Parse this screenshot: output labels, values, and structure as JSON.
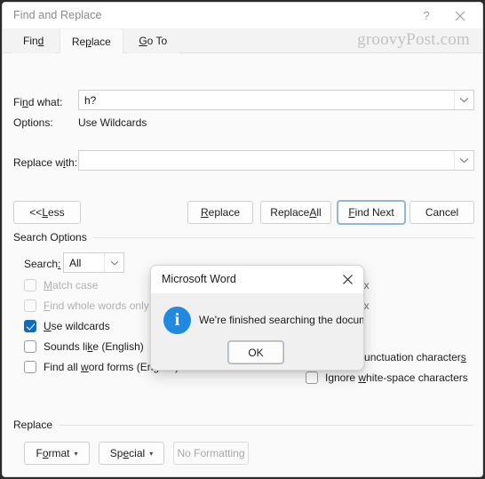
{
  "window": {
    "title": "Find and Replace",
    "help_icon": "question-mark-icon",
    "close_icon": "close-icon",
    "watermark": "groovyPost.com"
  },
  "tabs": [
    {
      "label": "Find",
      "prefix": "Fin",
      "accel": "d",
      "suffix": "",
      "active": false
    },
    {
      "label": "Replace",
      "prefix": "Re",
      "accel": "p",
      "suffix": "lace",
      "active": true
    },
    {
      "label": "Go To",
      "prefix": "",
      "accel": "G",
      "suffix": "o To",
      "active": false
    }
  ],
  "find": {
    "label_prefix": "Fi",
    "label_accel": "n",
    "label_suffix": "d what:",
    "value": "h?",
    "placeholder": "",
    "dropdown_icon": "chevron-down-icon"
  },
  "options": {
    "label": "Options:",
    "value": "Use Wildcards"
  },
  "replace": {
    "label_prefix": "Replace w",
    "label_accel": "i",
    "label_suffix": "th:",
    "value": "",
    "placeholder": "",
    "dropdown_icon": "chevron-down-icon"
  },
  "buttons": {
    "less": {
      "prefix": "<< ",
      "accel": "L",
      "suffix": "ess"
    },
    "replace": {
      "prefix": "",
      "accel": "R",
      "suffix": "eplace"
    },
    "replace_all": {
      "prefix": "Replace ",
      "accel": "A",
      "suffix": "ll"
    },
    "find_next": {
      "prefix": "",
      "accel": "F",
      "suffix": "ind Next",
      "focused": true
    },
    "cancel": {
      "prefix": "Cancel",
      "accel": "",
      "suffix": ""
    }
  },
  "search_options": {
    "group_label": "Search Options",
    "search_label_prefix": "Search",
    "search_label_accel": ":",
    "search_value": "All",
    "search_dropdown_icon": "chevron-down-icon",
    "left_checkboxes": [
      {
        "prefix": "",
        "accel": "M",
        "suffix": "atch case",
        "checked": false,
        "disabled": true
      },
      {
        "prefix": "",
        "accel": "F",
        "suffix": "ind whole words only",
        "checked": false,
        "disabled": true
      },
      {
        "prefix": "",
        "accel": "U",
        "suffix": "se wildcards",
        "checked": true,
        "disabled": false
      },
      {
        "prefix": "Sounds li",
        "accel": "k",
        "suffix": "e (English)",
        "checked": false,
        "disabled": false
      },
      {
        "prefix": "Find all ",
        "accel": "w",
        "suffix": "ord forms (English)",
        "checked": false,
        "disabled": false
      }
    ],
    "obscured_right_checkboxes": [
      {
        "visible_text": "ix"
      },
      {
        "visible_text": "ix"
      }
    ],
    "right_checkboxes": [
      {
        "prefix": "Ignore punctuation character",
        "accel": "s",
        "suffix": "",
        "checked": false,
        "disabled": false
      },
      {
        "prefix": "Ignore ",
        "accel": "w",
        "suffix": "hite-space characters",
        "checked": false,
        "disabled": false
      }
    ]
  },
  "replace_group": {
    "group_label": "Replace",
    "format": {
      "prefix": "F",
      "accel": "o",
      "suffix": "rmat",
      "caret": "▾"
    },
    "special": {
      "prefix": "Sp",
      "accel": "e",
      "suffix": "cial",
      "caret": "▾"
    },
    "no_formatting": {
      "prefix": "No Formatting",
      "accel": "",
      "suffix": "",
      "disabled": true
    }
  },
  "modal": {
    "title": "Microsoft Word",
    "close_icon": "close-icon",
    "info_icon": "info-icon",
    "info_glyph": "i",
    "message": "We're finished searching the document.",
    "ok_label": "OK"
  },
  "colors": {
    "accent": "#0f6cbd",
    "focus_border": "#8fb7e0",
    "info_blue": "#1f8ae0",
    "panel_bg": "#fafafa",
    "window_bg": "#f3f3f3",
    "disabled_text": "#b0b0b0"
  }
}
